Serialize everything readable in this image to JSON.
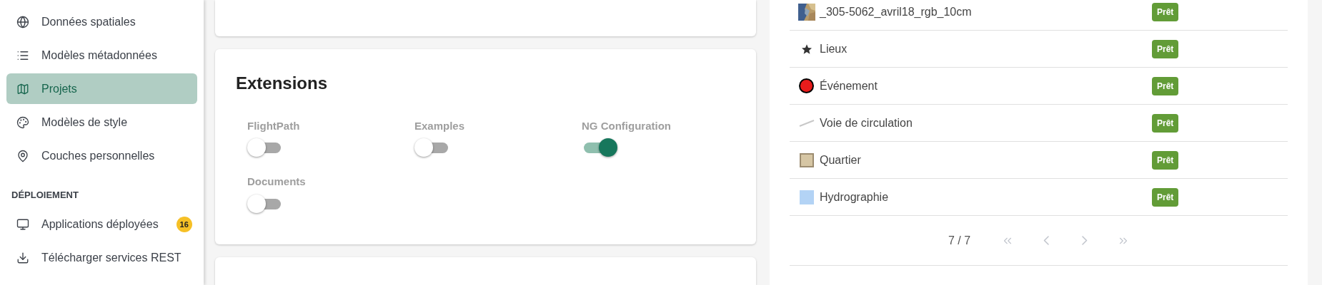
{
  "sidebar": {
    "items": [
      {
        "label": "Données spatiales",
        "selected": false
      },
      {
        "label": "Modèles métadonnées",
        "selected": false
      },
      {
        "label": "Projets",
        "selected": true
      },
      {
        "label": "Modèles de style",
        "selected": false
      },
      {
        "label": "Couches personnelles",
        "selected": false
      }
    ],
    "section": {
      "title": "DÉPLOIEMENT",
      "items": [
        {
          "label": "Applications déployées",
          "selected": false,
          "badge": "16"
        },
        {
          "label": "Télécharger services REST",
          "selected": false
        }
      ]
    }
  },
  "extensions": {
    "title": "Extensions",
    "toggles": [
      {
        "label": "FlightPath",
        "on": false
      },
      {
        "label": "Examples",
        "on": false
      },
      {
        "label": "NG Configuration",
        "on": true
      },
      {
        "label": "Documents",
        "on": false
      }
    ]
  },
  "layers": {
    "rows": [
      {
        "kind": "picture",
        "name": "_305-5062_avril18_rgb_10cm",
        "status": "Prêt"
      },
      {
        "kind": "star",
        "name": "Lieux",
        "status": "Prêt"
      },
      {
        "kind": "point",
        "color": "#e81c1c",
        "name": "Événement",
        "status": "Prêt"
      },
      {
        "kind": "line",
        "color": "#c8c8c8",
        "name": "Voie de circulation",
        "status": "Prêt"
      },
      {
        "kind": "polygon",
        "color": "#d6c6a4",
        "name": "Quartier",
        "status": "Prêt"
      },
      {
        "kind": "fill",
        "color": "#b3d3f5",
        "name": "Hydrographie",
        "status": "Prêt"
      }
    ],
    "pager": {
      "page": "7 / 7",
      "buttons": [
        {
          "kind": "first",
          "disabled": true
        },
        {
          "kind": "prev",
          "disabled": true
        },
        {
          "kind": "next",
          "disabled": true
        },
        {
          "kind": "last",
          "disabled": true
        }
      ]
    }
  }
}
